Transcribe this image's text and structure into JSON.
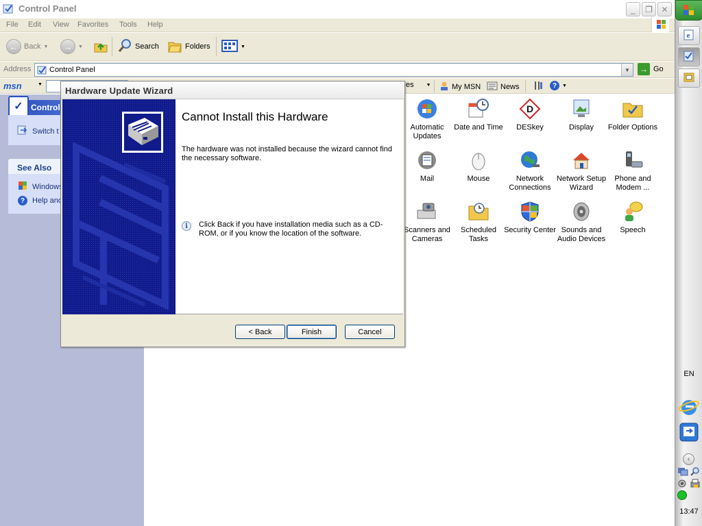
{
  "window": {
    "title": "Control Panel",
    "caption_buttons": [
      "minimize-icon",
      "restore-icon",
      "close-icon"
    ]
  },
  "menu": [
    "File",
    "Edit",
    "View",
    "Favorites",
    "Tools",
    "Help"
  ],
  "toolbar": {
    "back": "Back",
    "search": "Search",
    "folders": "Folders"
  },
  "address": {
    "label": "Address",
    "value": "Control Panel",
    "go": "Go"
  },
  "msn": {
    "logo": "msn",
    "partial_item": "es",
    "my_msn": "My MSN",
    "news": "News"
  },
  "taskpane": {
    "header": "Control",
    "switch": "Switch t",
    "see_also": "See Also",
    "see_also_items": [
      "Windows",
      "Help and"
    ]
  },
  "control_panel_items": [
    {
      "icon": "automatic-updates-icon",
      "label": "Automatic Updates"
    },
    {
      "icon": "date-time-icon",
      "label": "Date and Time"
    },
    {
      "icon": "deskey-icon",
      "label": "DESkey"
    },
    {
      "icon": "display-icon",
      "label": "Display"
    },
    {
      "icon": "folder-options-icon",
      "label": "Folder Options"
    },
    {
      "icon": "mail-icon",
      "label": "Mail"
    },
    {
      "icon": "mouse-icon",
      "label": "Mouse"
    },
    {
      "icon": "network-connections-icon",
      "label": "Network Connections"
    },
    {
      "icon": "network-setup-icon",
      "label": "Network Setup Wizard"
    },
    {
      "icon": "phone-modem-icon",
      "label": "Phone and Modem ..."
    },
    {
      "icon": "scanners-cameras-icon",
      "label": "Scanners and Cameras"
    },
    {
      "icon": "scheduled-tasks-icon",
      "label": "Scheduled Tasks"
    },
    {
      "icon": "security-center-icon",
      "label": "Security Center"
    },
    {
      "icon": "sounds-audio-icon",
      "label": "Sounds and Audio Devices"
    },
    {
      "icon": "speech-icon",
      "label": "Speech"
    }
  ],
  "wizard": {
    "title": "Hardware Update Wizard",
    "heading": "Cannot Install this Hardware",
    "description": "The hardware was not installed because the wizard cannot find the necessary software.",
    "info": "Click Back if you have installation media such as a CD-ROM, or if you know the location of the software.",
    "buttons": {
      "back": "< Back",
      "finish": "Finish",
      "cancel": "Cancel"
    }
  },
  "taskbar": {
    "language": "EN",
    "clock": "13:47"
  },
  "colors": {
    "wizard_side_panel": "#101a8a",
    "task_pane_bg": "#b6bcd7",
    "dialog_face": "#ece9d8",
    "start_button": "#2e8b2e"
  }
}
